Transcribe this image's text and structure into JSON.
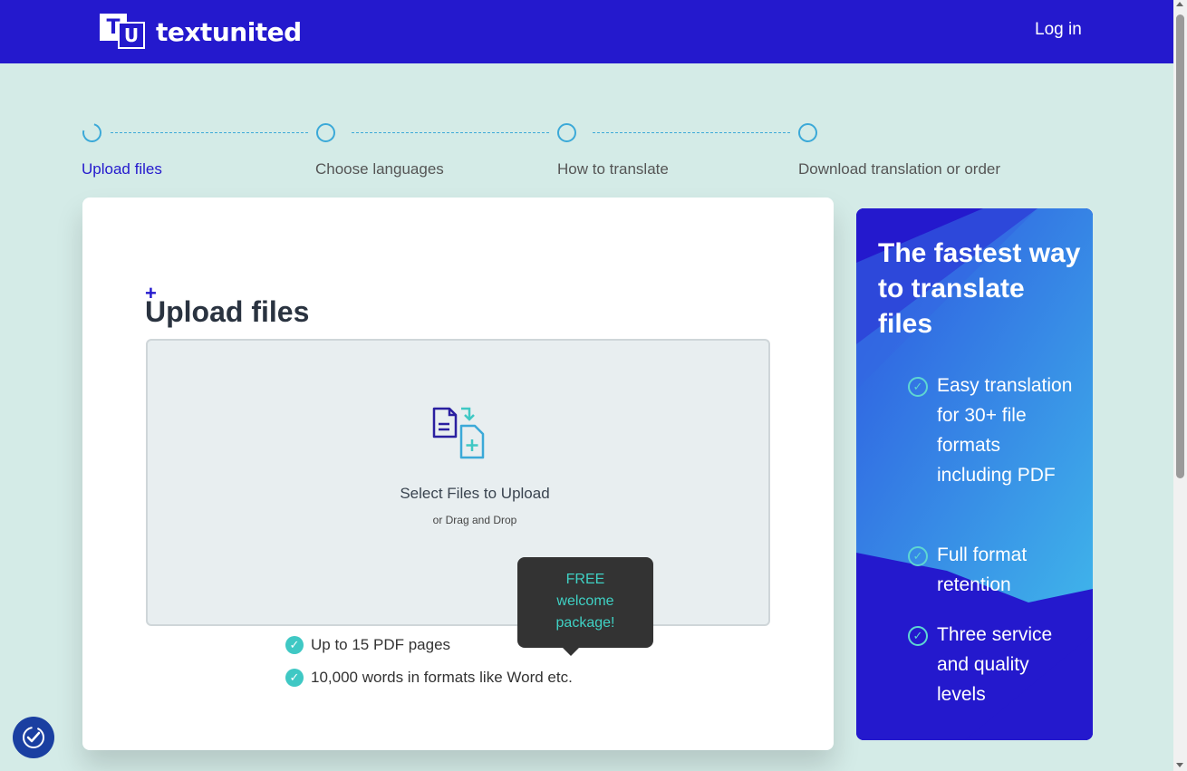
{
  "header": {
    "logo_t": "T",
    "logo_u": "U",
    "brand": "textunited",
    "login": "Log in"
  },
  "steps": [
    {
      "label": "Upload files",
      "active": true
    },
    {
      "label": "Choose languages",
      "active": false
    },
    {
      "label": "How to translate",
      "active": false
    },
    {
      "label": "Download translation or order",
      "active": false
    }
  ],
  "upload": {
    "plus": "+",
    "title": "Upload files",
    "select": "Select Files to Upload",
    "drag": "or Drag and Drop",
    "icon": "files-upload-icon"
  },
  "tooltip": {
    "text_line1": "FREE",
    "text_line2": "welcome",
    "text_line3": "package!"
  },
  "features": [
    "Up to 15 PDF pages",
    "10,000 words in formats like Word etc."
  ],
  "promo": {
    "title": "The fastest way to translate files",
    "items": [
      "Easy translation for 30+ file formats including PDF",
      "Full format retention",
      "Three service and quality levels"
    ]
  },
  "colors": {
    "brand_blue": "#2419cd",
    "teal": "#3fc8c4",
    "page_bg": "#d4ebe7"
  }
}
